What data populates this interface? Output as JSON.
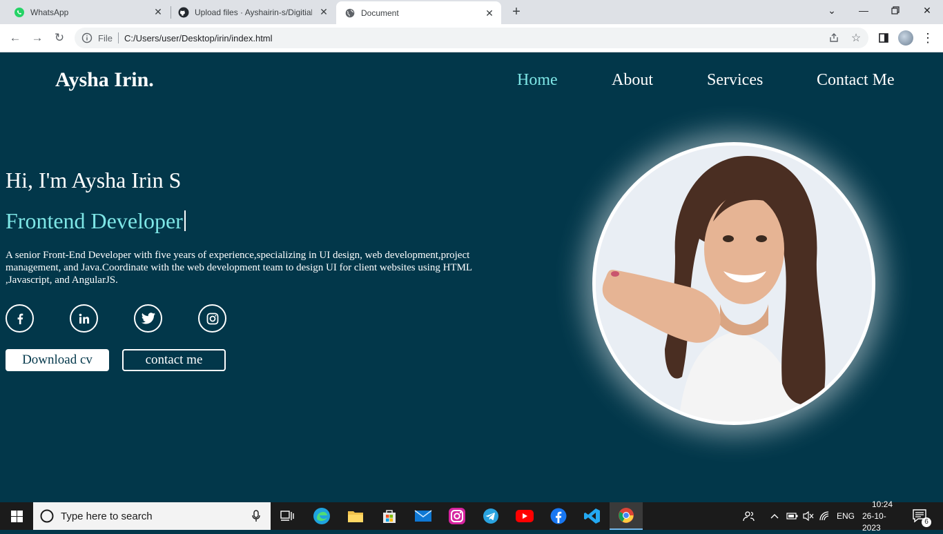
{
  "browser": {
    "tabs": [
      {
        "title": "WhatsApp",
        "icon": "whatsapp-icon",
        "active": false
      },
      {
        "title": "Upload files · Ayshairin-s/Digitial",
        "icon": "github-icon",
        "active": false
      },
      {
        "title": "Document",
        "icon": "globe-icon",
        "active": true
      }
    ],
    "address": {
      "scheme": "File",
      "url": "C:/Users/user/Desktop/irin/index.html"
    }
  },
  "site": {
    "logo": "Aysha Irin.",
    "nav": [
      "Home",
      "About",
      "Services",
      "Contact Me"
    ],
    "greeting": "Hi, I'm Aysha Irin S",
    "role": "Frontend Developer",
    "description": "A senior Front-End Developer with five years of experience,specializing in UI design, web development,project management, and Java.Coordinate with the web development team to design UI for client websites using HTML ,Javascript, and AngularJS.",
    "social": [
      "facebook-icon",
      "linkedin-icon",
      "twitter-icon",
      "instagram-icon"
    ],
    "buttons": {
      "download": "Download cv",
      "contact": "contact me"
    },
    "colors": {
      "background": "#02374a",
      "accent": "#7ee6e6"
    }
  },
  "taskbar": {
    "search_placeholder": "Type here to search",
    "language": "ENG",
    "time": "10:24",
    "date": "26-10-2023",
    "notifications": "6"
  }
}
